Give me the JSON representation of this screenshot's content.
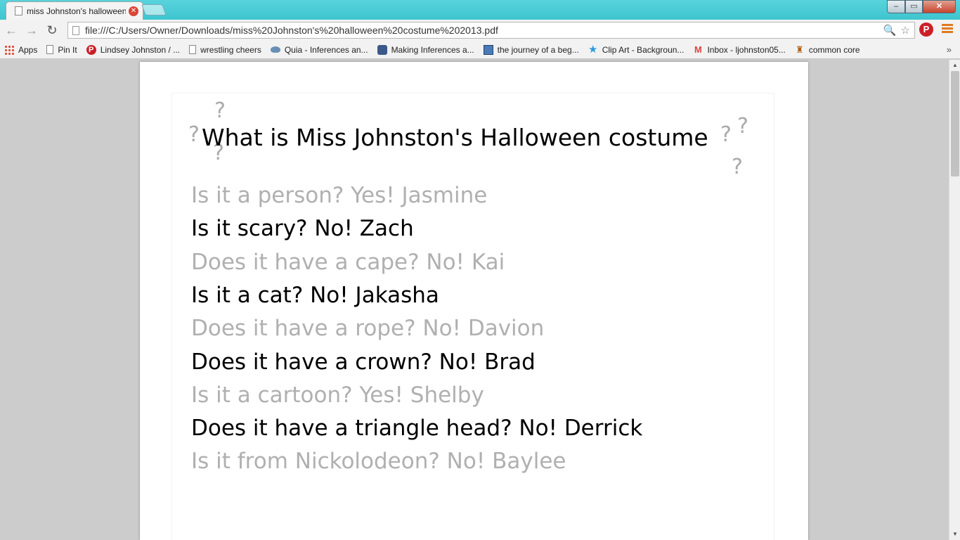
{
  "browser": {
    "tab_title": "miss Johnston's halloween",
    "tab_close": "✕",
    "window_controls": {
      "minimize": "‒",
      "maximize": "▭",
      "close": "✕"
    },
    "nav": {
      "back": "←",
      "forward": "→",
      "reload": "↻"
    },
    "url": "file:///C:/Users/Owner/Downloads/miss%20Johnston's%20halloween%20costume%202013.pdf",
    "omnibox_icons": {
      "search": "🔍",
      "star": "☆"
    },
    "pinterest_ext": "P"
  },
  "bookmarks": [
    {
      "label": "Apps",
      "icon": "apps-icon"
    },
    {
      "label": "Pin It",
      "icon": "page-icon"
    },
    {
      "label": "Lindsey Johnston / ...",
      "icon": "pinterest-icon"
    },
    {
      "label": "wrestling cheers",
      "icon": "page-icon"
    },
    {
      "label": "Quia - Inferences an...",
      "icon": "quia-icon"
    },
    {
      "label": "Making Inferences a...",
      "icon": "inference-icon"
    },
    {
      "label": "the journey of a beg...",
      "icon": "journey-icon"
    },
    {
      "label": "Clip Art - Backgroun...",
      "icon": "star-icon"
    },
    {
      "label": "Inbox - ljohnston05...",
      "icon": "gmail-icon"
    },
    {
      "label": "common core",
      "icon": "witch-icon"
    }
  ],
  "bookmarks_more": "»",
  "document": {
    "title": "What is Miss Johnston's Halloween costume",
    "question_mark": "?",
    "guesses": [
      {
        "text": "Is it a person? Yes! Jasmine",
        "tone": "gray"
      },
      {
        "text": "Is it scary? No! Zach",
        "tone": "black"
      },
      {
        "text": "Does it have a cape? No! Kai",
        "tone": "gray"
      },
      {
        "text": "Is it a cat? No! Jakasha",
        "tone": "black"
      },
      {
        "text": "Does it have a rope? No! Davion",
        "tone": "gray"
      },
      {
        "text": "Does it have a crown? No! Brad",
        "tone": "black"
      },
      {
        "text": "Is it a cartoon? Yes! Shelby",
        "tone": "gray"
      },
      {
        "text": "Does it have a triangle head? No! Derrick",
        "tone": "black"
      },
      {
        "text": "Is it from Nickolodeon? No! Baylee",
        "tone": "gray"
      }
    ]
  },
  "scrollbar": {
    "up": "▲",
    "down": "▼"
  }
}
